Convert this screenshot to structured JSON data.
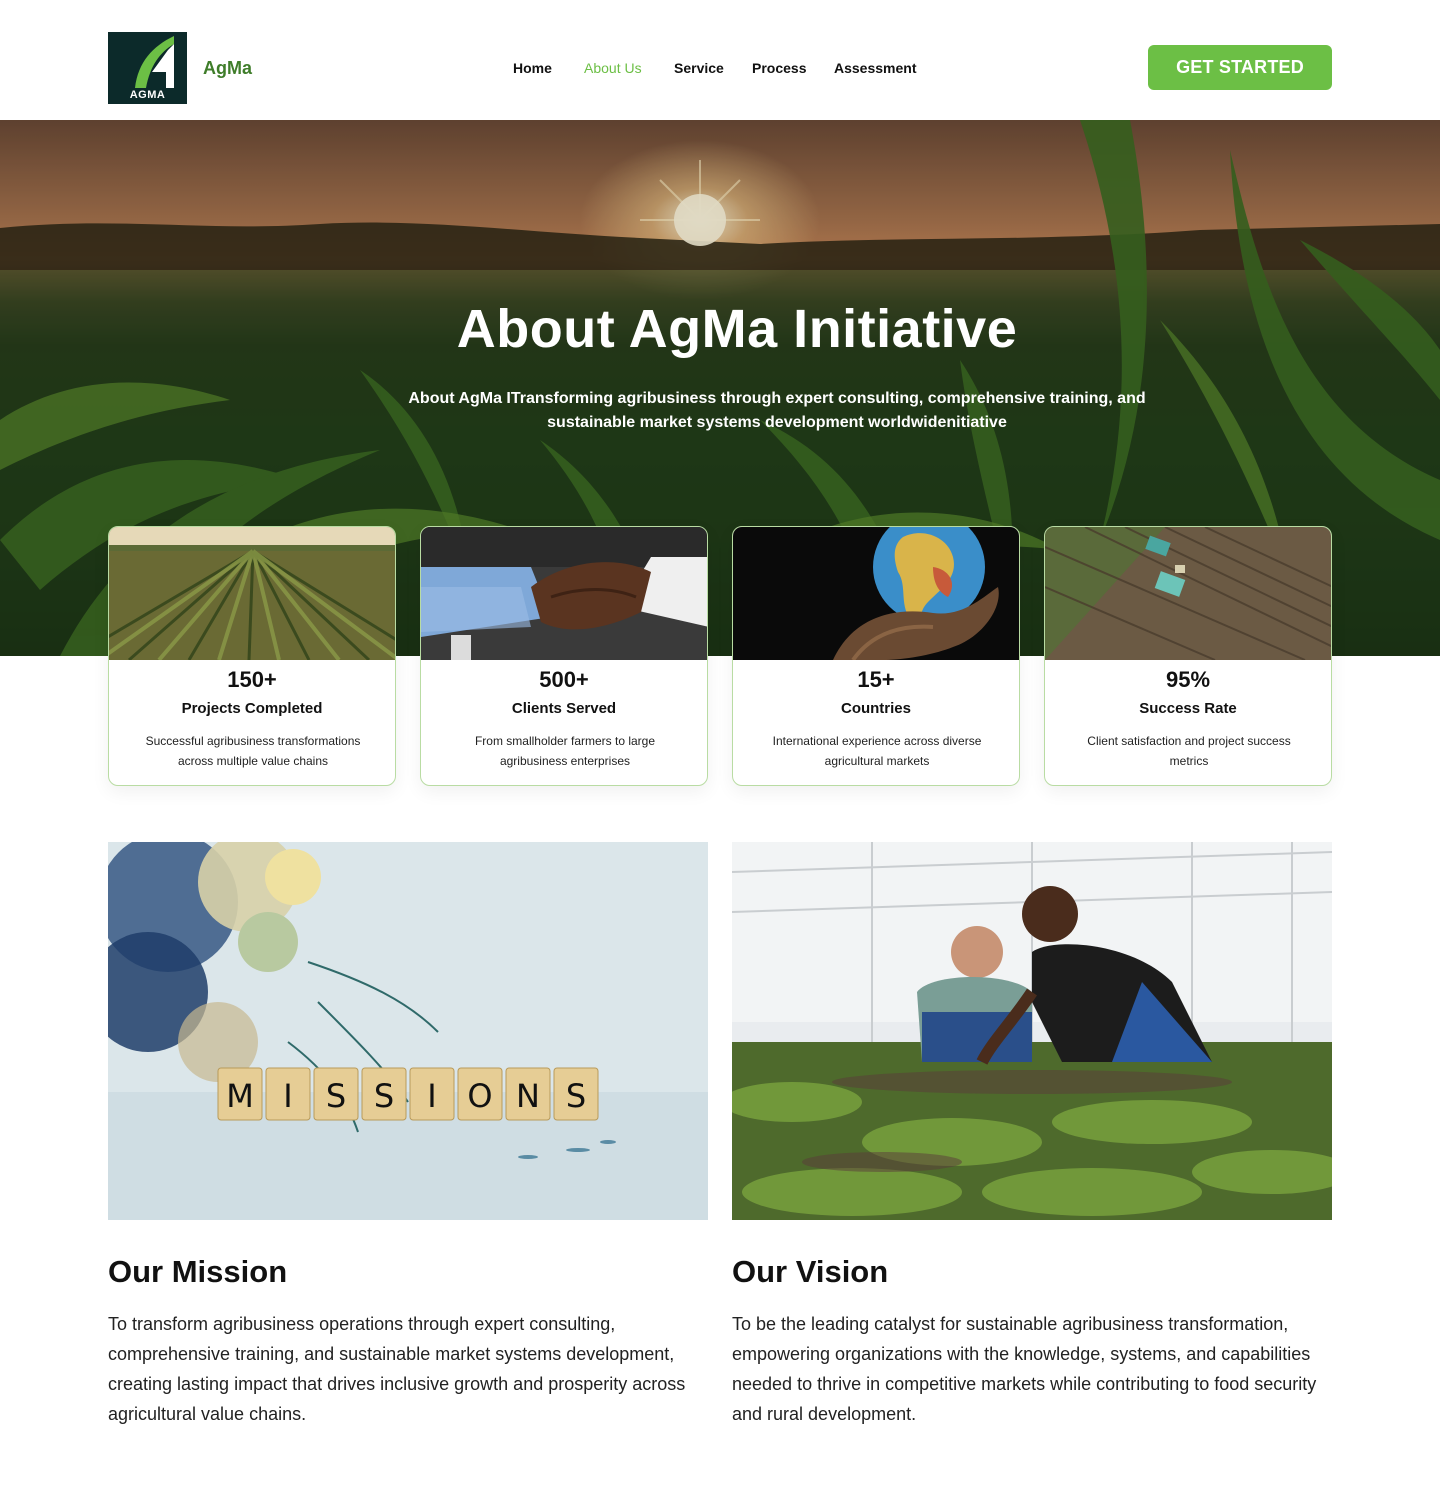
{
  "header": {
    "logo_text": "AGMA",
    "brand": "AgMa",
    "nav": [
      "Home",
      "About Us",
      "Service",
      "Process",
      "Assessment"
    ],
    "active_nav": "About Us",
    "cta": "GET STARTED"
  },
  "hero": {
    "title": "About AgMa Initiative",
    "subtitle": "About AgMa ITransforming agribusiness through expert consulting, comprehensive training, and sustainable market systems development worldwidenitiative"
  },
  "stats": [
    {
      "number": "150+",
      "label": "Projects Completed",
      "description": "Successful agribusiness transformations across multiple value chains",
      "image": "crop-field-rows"
    },
    {
      "number": "500+",
      "label": "Clients Served",
      "description": "From smallholder farmers to large agribusiness enterprises",
      "image": "handshake"
    },
    {
      "number": "15+",
      "label": "Countries",
      "description": "International experience across diverse agricultural markets",
      "image": "globe-in-hand"
    },
    {
      "number": "95%",
      "label": "Success Rate",
      "description": "Client satisfaction and project success metrics",
      "image": "aerial-tractor-field"
    }
  ],
  "mission": {
    "image_tiles": [
      "M",
      "I",
      "S",
      "S",
      "I",
      "O",
      "N",
      "S"
    ],
    "title": "Our Mission",
    "text": "To transform agribusiness operations through expert consulting, comprehensive training, and sustainable market systems development, creating lasting impact that drives inclusive growth and prosperity across agricultural value chains."
  },
  "vision": {
    "image": "greenhouse-farmers",
    "title": "Our Vision",
    "text": "To be the leading catalyst for sustainable agribusiness transformation, empowering organizations with the knowledge, systems, and capabilities needed to thrive in competitive markets while contributing to food security and rural development."
  },
  "colors": {
    "accent": "#6cbf45",
    "brand_text": "#3f7d2a",
    "logo_bg": "#0c2a2a",
    "card_border": "#b9dca3"
  }
}
